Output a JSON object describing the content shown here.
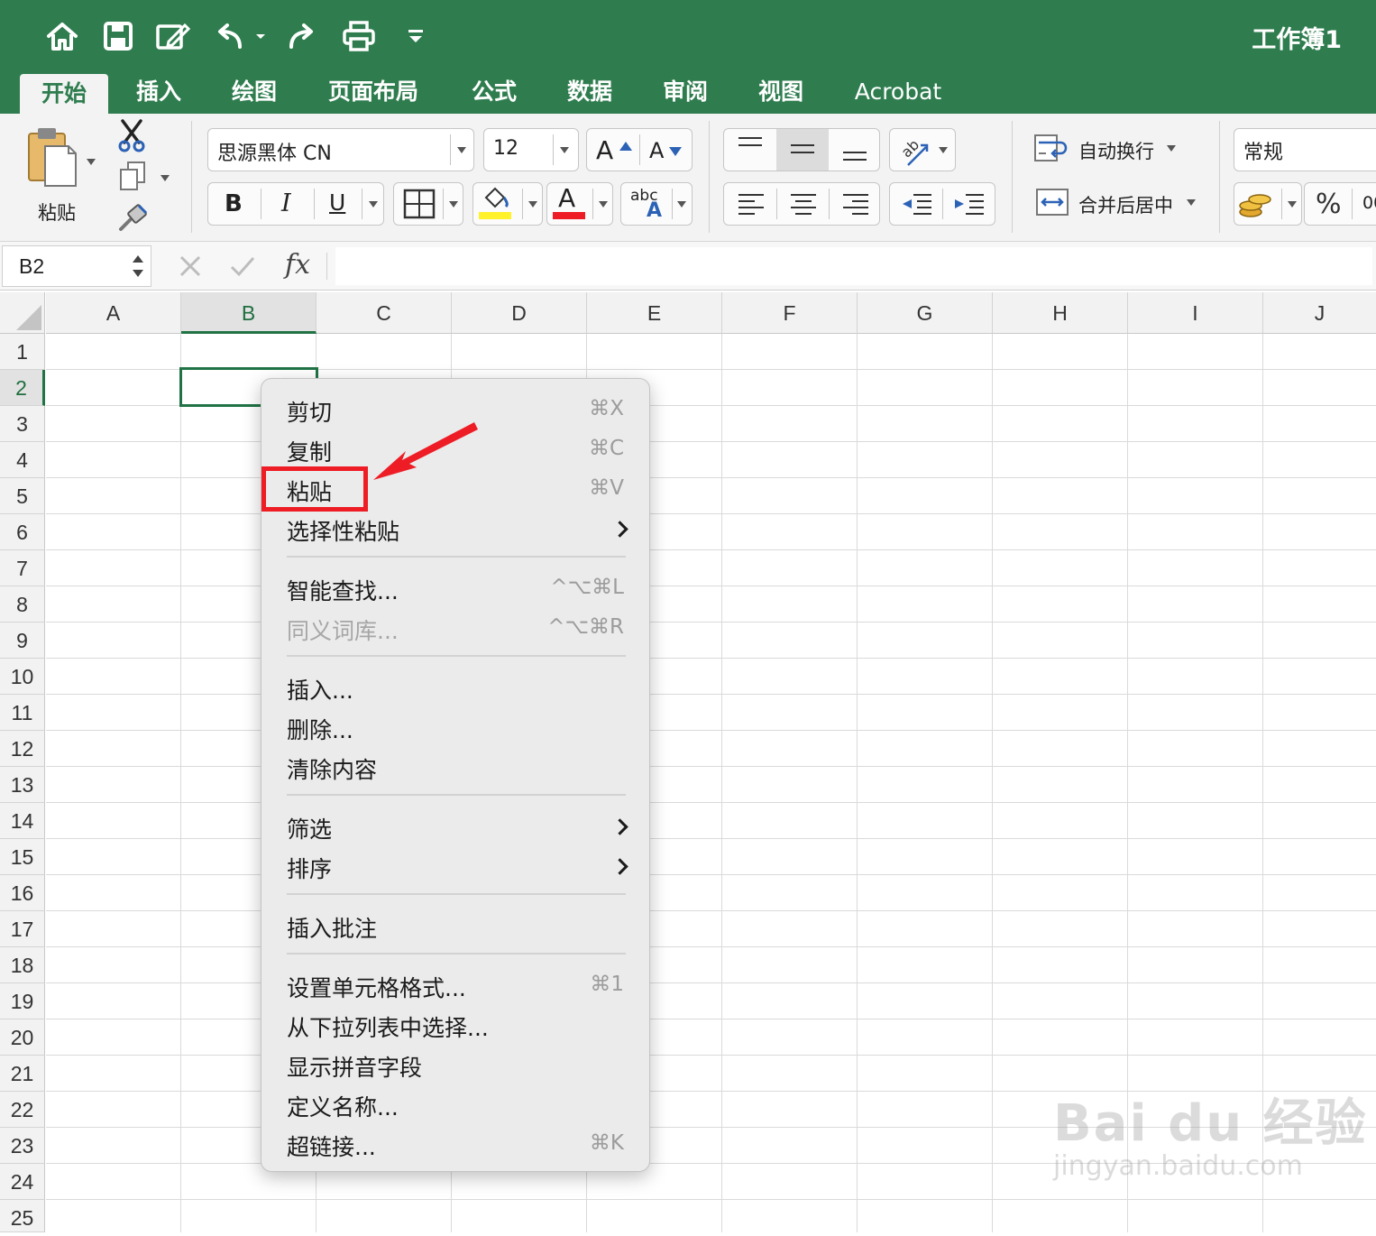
{
  "title": "工作簿1",
  "tabs": [
    "开始",
    "插入",
    "绘图",
    "页面布局",
    "公式",
    "数据",
    "审阅",
    "视图",
    "Acrobat"
  ],
  "active_tab": "开始",
  "ribbon": {
    "paste_label": "粘贴",
    "font_name": "思源黑体 CN",
    "font_size": "12",
    "increase_font_label": "A",
    "decrease_font_label": "A",
    "bold": "B",
    "italic": "I",
    "underline": "U",
    "font_color_letter": "A",
    "phonetic_top": "abc",
    "phonetic_bottom": "A",
    "wrap_text": "自动换行",
    "merge_center": "合并后居中",
    "number_format": "常规",
    "percent": "%",
    "comma_partial": "00"
  },
  "formula_bar": {
    "name_box": "B2",
    "fx": "fx",
    "formula": ""
  },
  "grid": {
    "columns": [
      "A",
      "B",
      "C",
      "D",
      "E",
      "F",
      "G",
      "H",
      "I",
      "J"
    ],
    "rows": [
      "1",
      "2",
      "3",
      "4",
      "5",
      "6",
      "7",
      "8",
      "9",
      "10",
      "11",
      "12",
      "13",
      "14",
      "15",
      "16",
      "17",
      "18",
      "19",
      "20",
      "21",
      "22",
      "23",
      "24",
      "25"
    ],
    "selected_column": "B",
    "selected_row": "2"
  },
  "context_menu": {
    "items": [
      {
        "label": "剪切",
        "shortcut": "⌘X"
      },
      {
        "label": "复制",
        "shortcut": "⌘C"
      },
      {
        "label": "粘贴",
        "shortcut": "⌘V"
      },
      {
        "label": "选择性粘贴",
        "submenu": true
      },
      {
        "label": "智能查找...",
        "shortcut": "^⌥⌘L"
      },
      {
        "label": "同义词库...",
        "shortcut": "^⌥⌘R",
        "disabled": true
      },
      {
        "label": "插入..."
      },
      {
        "label": "删除..."
      },
      {
        "label": "清除内容"
      },
      {
        "label": "筛选",
        "submenu": true
      },
      {
        "label": "排序",
        "submenu": true
      },
      {
        "label": "插入批注"
      },
      {
        "label": "设置单元格格式...",
        "shortcut": "⌘1"
      },
      {
        "label": "从下拉列表中选择..."
      },
      {
        "label": "显示拼音字段"
      },
      {
        "label": "定义名称..."
      },
      {
        "label": "超链接...",
        "shortcut": "⌘K"
      }
    ]
  },
  "watermark": {
    "top": "Bai du 经验",
    "bottom": "jingyan.baidu.com"
  },
  "colors": {
    "accent": "#2f7d4f",
    "selection": "#217346",
    "annotation": "#ee1c25"
  }
}
